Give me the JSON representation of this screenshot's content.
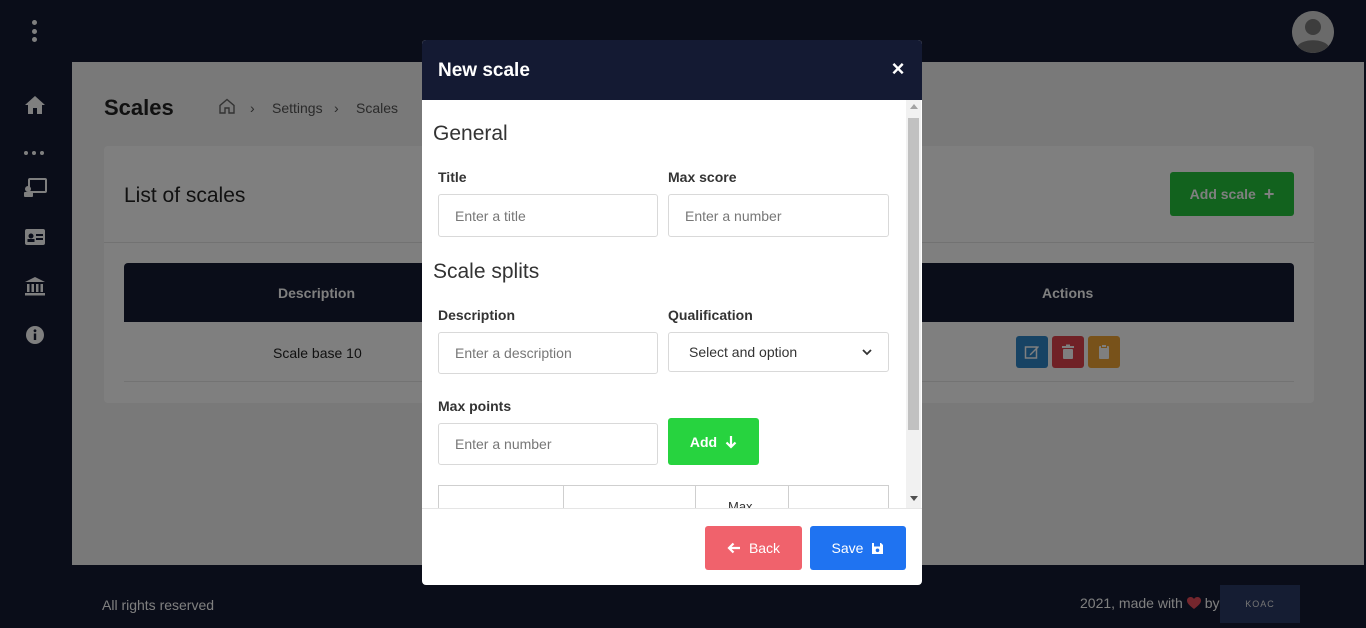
{
  "page": {
    "title": "Scales",
    "breadcrumb": [
      "Settings",
      "Scales"
    ]
  },
  "card": {
    "title": "List of scales",
    "add_button_label": "Add scale",
    "table": {
      "headers": [
        "Description",
        "Actions"
      ],
      "rows": [
        {
          "description": "Scale base 10"
        }
      ]
    }
  },
  "footer": {
    "left_text": "All rights reserved",
    "right_text": "2021, made with",
    "by_text": "by",
    "logo_text": "KOAC"
  },
  "modal": {
    "title": "New scale",
    "general_section": "General",
    "title_label": "Title",
    "title_placeholder": "Enter a title",
    "max_score_label": "Max score",
    "max_score_placeholder": "Enter a number",
    "splits_section": "Scale splits",
    "description_label": "Description",
    "description_placeholder": "Enter a description",
    "qualification_label": "Qualification",
    "qualification_value": "Select and option",
    "max_points_label": "Max points",
    "max_points_placeholder": "Enter a number",
    "add_label": "Add",
    "splits_table_partial_header": "Max",
    "back_label": "Back",
    "save_label": "Save"
  },
  "colors": {
    "navy": "#141a33",
    "green": "#25c43c",
    "add_green": "#27d33f",
    "edit_blue": "#2f86c9",
    "delete_red": "#e0434c",
    "copy_orange": "#f0a534",
    "back_red": "#f0626c",
    "save_blue": "#1f73f1"
  },
  "icons": {
    "menu": "vertical-dots-icon",
    "home": "home-icon",
    "more": "horizontal-dots-icon",
    "class": "teacher-board-icon",
    "idcard": "id-card-icon",
    "institution": "bank-icon",
    "info": "info-icon"
  }
}
